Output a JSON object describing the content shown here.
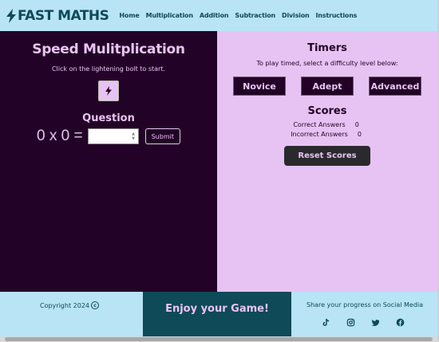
{
  "brand": {
    "name": "FAST MATHS"
  },
  "nav": {
    "items": [
      "Home",
      "Multiplication",
      "Addition",
      "Subtraction",
      "Division",
      "Instructions"
    ]
  },
  "game": {
    "title": "Speed Mulitplication",
    "hint": "Click on the lightening bolt to start.",
    "question_heading": "Question",
    "expression": "0 x 0 =",
    "answer_value": "",
    "submit_label": "Submit"
  },
  "timers": {
    "title": "Timers",
    "hint": "To play timed, select a difficulty level below:",
    "levels": [
      "Novice",
      "Adept",
      "Advanced"
    ]
  },
  "scores": {
    "title": "Scores",
    "correct_label": "Correct Answers",
    "correct_value": "0",
    "incorrect_label": "Incorrect Answers",
    "incorrect_value": "0",
    "reset_label": "Reset Scores"
  },
  "footer": {
    "copyright": "Copyright 2024",
    "tagline": "Enjoy your Game!",
    "share": "Share your progress on Social Media",
    "socials": [
      "tiktok-icon",
      "instagram-icon",
      "twitter-icon",
      "facebook-icon"
    ]
  },
  "colors": {
    "dark_panel": "#220226",
    "light_panel": "#e7c3f3",
    "header": "#b8e4f5",
    "brand_text": "#0e4a58"
  }
}
